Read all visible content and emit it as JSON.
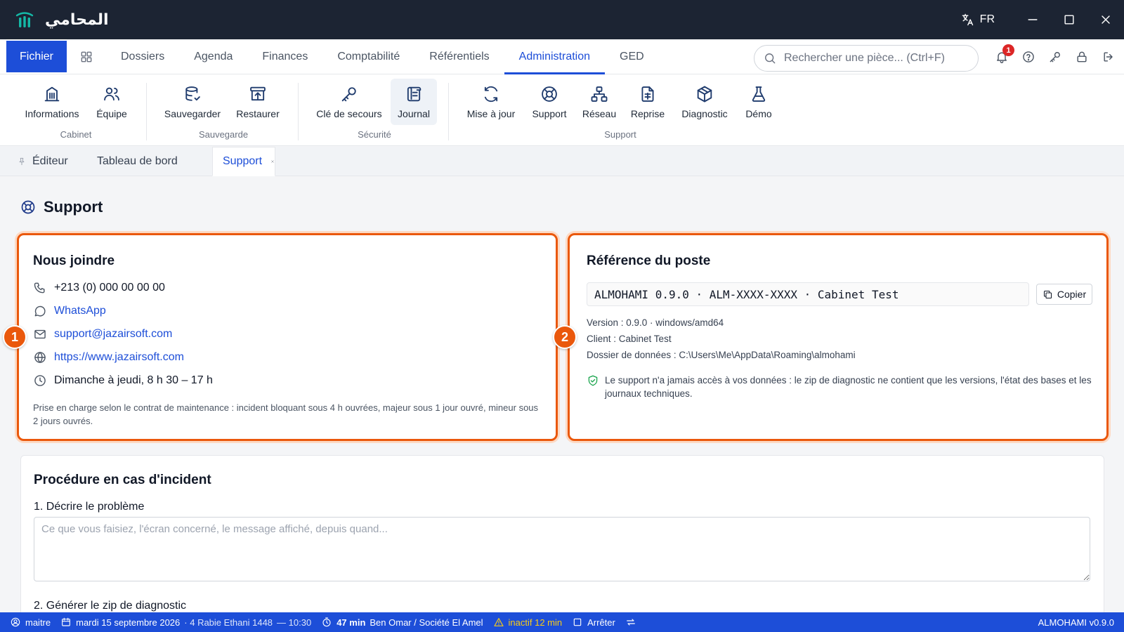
{
  "app": {
    "name": "المحامي",
    "language": "FR"
  },
  "menu": {
    "file": "Fichier",
    "items": [
      "Dossiers",
      "Agenda",
      "Finances",
      "Comptabilité",
      "Référentiels",
      "Administration",
      "GED"
    ],
    "active": "Administration",
    "search_placeholder": "Rechercher une pièce... (Ctrl+F)",
    "notifications_count": "1"
  },
  "ribbon": {
    "groups": {
      "cabinet": "Cabinet",
      "sauvegarde": "Sauvegarde",
      "securite": "Sécurité",
      "support": "Support"
    },
    "buttons": {
      "informations": "Informations",
      "equipe": "Équipe",
      "sauvegarder": "Sauvegarder",
      "restaurer": "Restaurer",
      "cle": "Clé de secours",
      "journal": "Journal",
      "maj": "Mise à jour",
      "support": "Support",
      "reseau": "Réseau",
      "reprise": "Reprise",
      "diagnostic": "Diagnostic",
      "demo": "Démo"
    }
  },
  "tabs": {
    "editeur": "Éditeur",
    "tableau": "Tableau de bord",
    "support": "Support"
  },
  "page": {
    "title": "Support"
  },
  "contact": {
    "title": "Nous joindre",
    "phone": "+213 (0) 000 00 00 00",
    "whatsapp": "WhatsApp",
    "email": "support@jazairsoft.com",
    "website": "https://www.jazairsoft.com",
    "hours": "Dimanche à jeudi, 8 h 30 – 17 h",
    "sla": "Prise en charge selon le contrat de maintenance : incident bloquant sous 4 h ouvrées, majeur sous 1 jour ouvré, mineur sous 2 jours ouvrés.",
    "marker": "1"
  },
  "reference": {
    "title": "Référence du poste",
    "code": "ALMOHAMI 0.9.0 · ALM-XXXX-XXXX · Cabinet Test",
    "copy": "Copier",
    "version": "Version : 0.9.0 · windows/amd64",
    "client": "Client : Cabinet Test",
    "data_dir": "Dossier de données : C:\\Users\\Me\\AppData\\Roaming\\almohami",
    "privacy": "Le support n'a jamais accès à vos données : le zip de diagnostic ne contient que les versions, l'état des bases et les journaux techniques.",
    "marker": "2"
  },
  "procedure": {
    "title": "Procédure en cas d'incident",
    "step1": "1. Décrire le problème",
    "step1_placeholder": "Ce que vous faisiez, l'écran concerné, le message affiché, depuis quand...",
    "step2": "2. Générer le zip de diagnostic"
  },
  "status": {
    "user": "maitre",
    "date": "mardi 15 septembre 2026",
    "hijri": "· 4 Rabie Ethani 1448",
    "time": "— 10:30",
    "timer": "47 min",
    "client": "Ben Omar / Société El Amel",
    "inactive": "inactif 12 min",
    "stop": "Arrêter",
    "version": "ALMOHAMI v0.9.0"
  },
  "colors": {
    "primary": "#1d4ed8",
    "titlebar": "#1c2433",
    "highlight": "#ea580c",
    "accent_logo": "#14b8a6"
  }
}
